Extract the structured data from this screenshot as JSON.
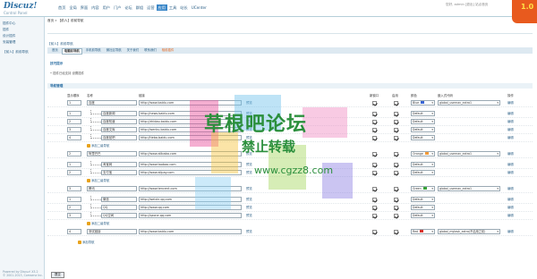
{
  "header": {
    "logo": "Discuz!",
    "logo_sub": "Control Panel",
    "nav": [
      "首页",
      "全局",
      "界面",
      "内容",
      "用户",
      "门户",
      "论坛",
      "群组",
      "运营",
      "应用",
      "工具",
      "站长",
      "UCenter"
    ],
    "active_nav": "应用",
    "user_area": "您好, admin [退出]   站点首页",
    "badge_text": "1.0"
  },
  "sidebar": {
    "items": [
      "插件中心",
      "插件",
      "设计插件",
      "安装管理",
      "【前人】前前导航"
    ],
    "footer": [
      "Powered by Discuz! X3.2",
      "© 2001-2013, Comsenz Inc."
    ]
  },
  "main": {
    "crumb": "首页 » 【前人】前前导航",
    "title": "【前人】前前导航",
    "tabs": [
      "首页",
      "电脑前导航",
      "手机前导航",
      "微社区导航",
      "关于我们",
      "联系我们",
      "相前插件"
    ],
    "active_tab": "电脑前导航",
    "warn_tab": "相前插件",
    "tips_title": "技巧提示",
    "tips_text": "插件已经支持 设置插件",
    "tips_link": "设置插件",
    "section_title": "导航管理",
    "columns": [
      "显示顺序",
      "名称",
      "链接",
      "新窗口",
      "启用",
      "颜色",
      "嵌入式代码",
      "操作"
    ],
    "rows": [
      {
        "order": "1",
        "name": "百度",
        "url": "http://www.baidu.com",
        "level": 0,
        "newwin": true,
        "enable": true,
        "color": "Blue",
        "color_hex": "#3b67d4",
        "code": "global_usernav_extra1"
      },
      {
        "order": "1",
        "name": "百度新闻",
        "url": "http://news.baidu.com",
        "level": 1,
        "newwin": true,
        "enable": true,
        "color": "Default",
        "color_hex": "",
        "code": ""
      },
      {
        "order": "2",
        "name": "百度知道",
        "url": "http://zhidao.baidu.com",
        "level": 1,
        "newwin": true,
        "enable": true,
        "color": "Default",
        "color_hex": "",
        "code": ""
      },
      {
        "order": "3",
        "name": "百度文库",
        "url": "http://wenku.baidu.com",
        "level": 1,
        "newwin": true,
        "enable": true,
        "color": "Default",
        "color_hex": "",
        "code": ""
      },
      {
        "order": "4",
        "name": "百度贴吧",
        "url": "http://tieba.baidu.com",
        "level": 1,
        "newwin": true,
        "enable": true,
        "color": "Default",
        "color_hex": "",
        "code": ""
      },
      {
        "type": "add",
        "label": "添加二级导航"
      },
      {
        "order": "2",
        "name": "阿里巴巴",
        "url": "http://www.alibaba.com",
        "level": 0,
        "newwin": true,
        "enable": true,
        "color": "Orange",
        "color_hex": "#f29b3a",
        "code": "global_usernav_extra1"
      },
      {
        "order": "1",
        "name": "淘宝网",
        "url": "http://www.taobao.com",
        "level": 1,
        "newwin": true,
        "enable": true,
        "color": "Default",
        "color_hex": "",
        "code": ""
      },
      {
        "order": "2",
        "name": "支付宝",
        "url": "http://www.alipay.com",
        "level": 1,
        "newwin": true,
        "enable": true,
        "color": "Default",
        "color_hex": "",
        "code": ""
      },
      {
        "type": "add",
        "label": "添加二级导航"
      },
      {
        "order": "3",
        "name": "腾讯",
        "url": "http://www.tencent.com",
        "level": 0,
        "newwin": true,
        "enable": true,
        "color": "Green",
        "color_hex": "#3aa339",
        "code": "global_usernav_extra1"
      },
      {
        "order": "1",
        "name": "微信",
        "url": "http://weixin.qq.com",
        "level": 1,
        "newwin": true,
        "enable": true,
        "color": "Default",
        "color_hex": "",
        "code": ""
      },
      {
        "order": "2",
        "name": "QQ",
        "url": "http://www.qq.com",
        "level": 1,
        "newwin": true,
        "enable": true,
        "color": "Default",
        "color_hex": "",
        "code": ""
      },
      {
        "order": "3",
        "name": "QQ空间",
        "url": "http://qzone.qq.com",
        "level": 1,
        "newwin": true,
        "enable": true,
        "color": "Default",
        "color_hex": "",
        "code": ""
      },
      {
        "type": "add",
        "label": "添加二级导航"
      },
      {
        "order": "4",
        "name": "测试链接",
        "url": "http://www.baidu.com",
        "level": 0,
        "newwin": true,
        "enable": true,
        "color": "Red",
        "color_hex": "#d8322b",
        "code": "global_mytask_extra(不启用之前)"
      },
      {
        "type": "add",
        "label": "添加导航"
      }
    ],
    "edit_label": "编辑",
    "preview_label": "预览",
    "submit_label": "提交"
  },
  "watermark": {
    "line1": "草根吧论坛",
    "line2": "禁止转载",
    "line3": "www.cgzz8.com"
  }
}
